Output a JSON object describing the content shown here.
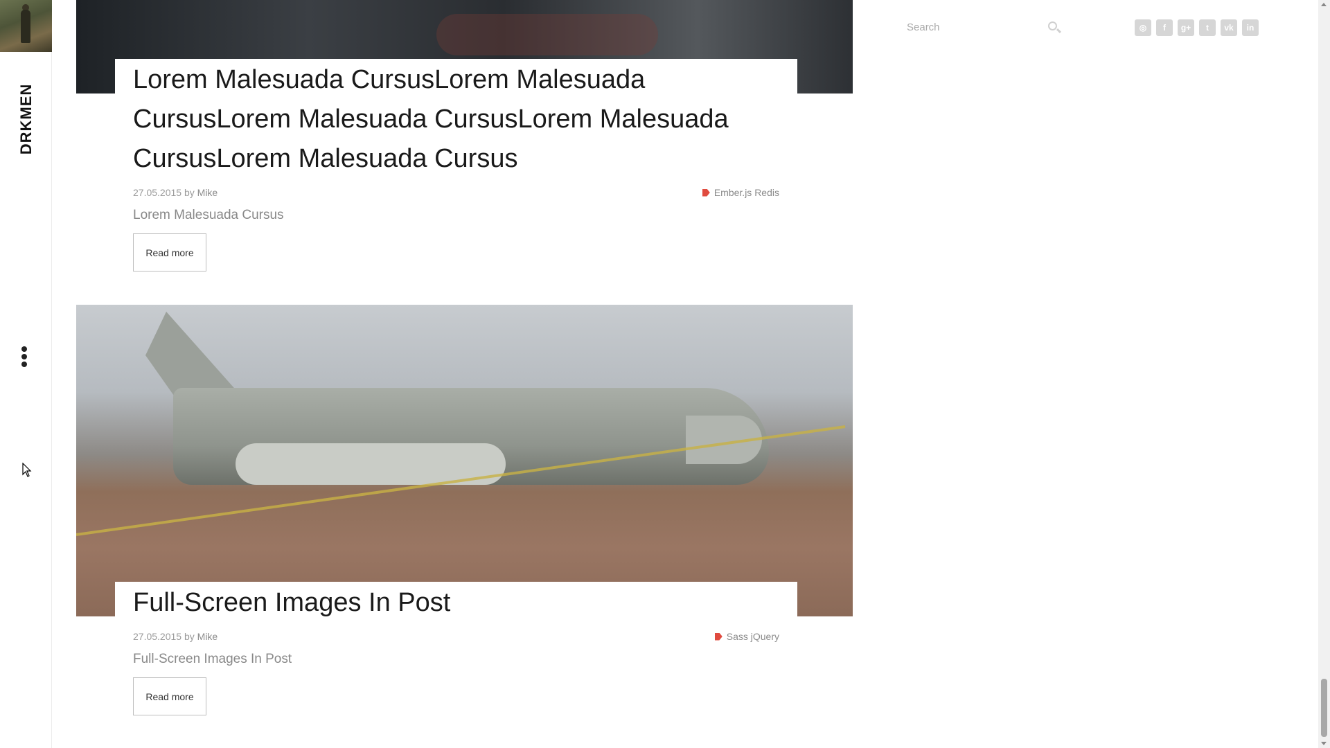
{
  "brand": {
    "name": "DRKMEN"
  },
  "search": {
    "placeholder": "Search"
  },
  "socials": [
    {
      "icon": "github-icon",
      "glyph": "◎"
    },
    {
      "icon": "facebook-icon",
      "glyph": "f"
    },
    {
      "icon": "google-plus-icon",
      "glyph": "g+"
    },
    {
      "icon": "twitter-icon",
      "glyph": "t"
    },
    {
      "icon": "vk-icon",
      "glyph": "vk"
    },
    {
      "icon": "linkedin-icon",
      "glyph": "in"
    }
  ],
  "posts": [
    {
      "title": "Lorem Malesuada CursusLorem Malesuada CursusLorem Malesuada CursusLorem Malesuada CursusLorem Malesuada Cursus",
      "date": "27.05.2015",
      "by": "by",
      "author": "Mike",
      "tags": "Ember.js Redis",
      "excerpt": "Lorem Malesuada Cursus",
      "read_more": "Read more"
    },
    {
      "title": "Full-Screen Images In Post",
      "date": "27.05.2015",
      "by": "by",
      "author": "Mike",
      "tags": "Sass jQuery",
      "excerpt": "Full-Screen Images In Post",
      "read_more": "Read more"
    }
  ],
  "colors": {
    "tag_accent": "#e04b3f",
    "social_bg": "#d6d6d6",
    "text_title": "#1a1a1a"
  }
}
